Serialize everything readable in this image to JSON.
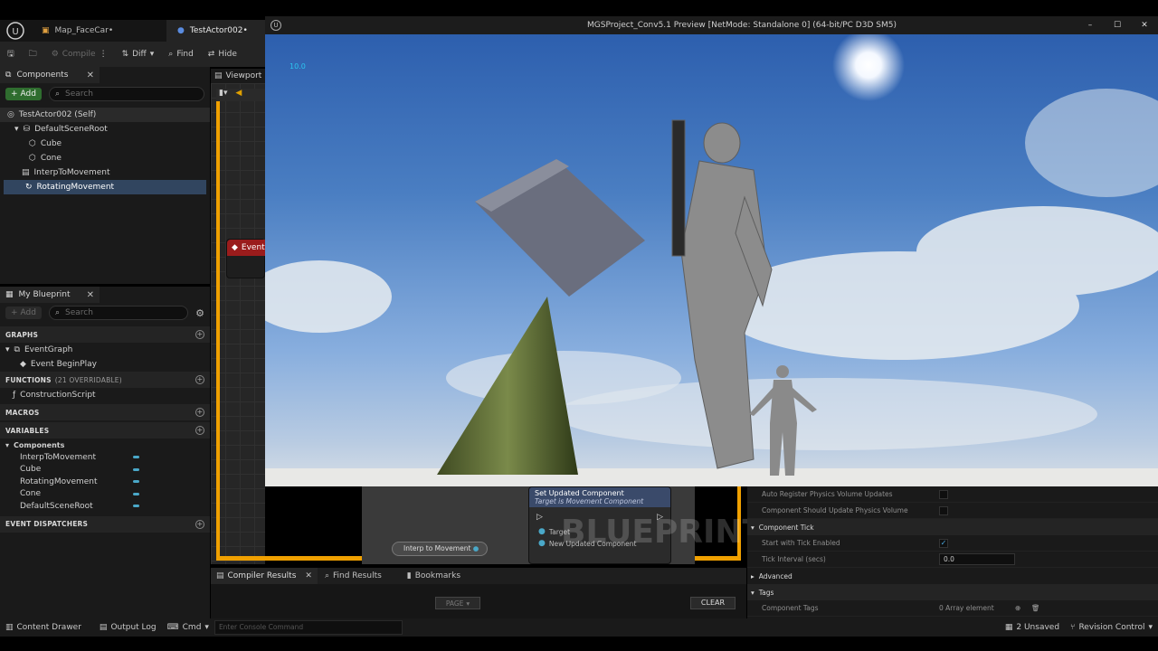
{
  "tabs": [
    {
      "label": "Map_FaceCar•",
      "active": false
    },
    {
      "label": "TestActor002•",
      "active": true
    }
  ],
  "toolbar": {
    "compile": "Compile",
    "diff": "Diff",
    "find": "Find",
    "hide": "Hide"
  },
  "components_panel": {
    "title": "Components",
    "add": "Add",
    "search_placeholder": "Search",
    "items": [
      {
        "label": "TestActor002 (Self)"
      },
      {
        "label": "DefaultSceneRoot"
      },
      {
        "label": "Cube"
      },
      {
        "label": "Cone"
      },
      {
        "label": "InterpToMovement"
      },
      {
        "label": "RotatingMovement"
      }
    ]
  },
  "my_blueprint": {
    "title": "My Blueprint",
    "add": "Add",
    "search_placeholder": "Search",
    "graphs_header": "GRAPHS",
    "event_graph": "EventGraph",
    "begin_play": "Event BeginPlay",
    "functions_header": "FUNCTIONS",
    "functions_count": "(21 OVERRIDABLE)",
    "construction_script": "ConstructionScript",
    "macros_header": "MACROS",
    "variables_header": "VARIABLES",
    "components_group": "Components",
    "variables": [
      "InterpToMovement",
      "Cube",
      "RotatingMovement",
      "Cone",
      "DefaultSceneRoot"
    ],
    "dispatchers_header": "EVENT DISPATCHERS"
  },
  "viewport_tab": "Viewport",
  "graph_node_event": "Event",
  "preview_window": {
    "title": "MGSProject_Conv5.1 Preview [NetMode: Standalone 0]  (64-bit/PC D3D SM5)",
    "overlay_value": "10.0"
  },
  "bottom_graph": {
    "node_title": "Set Updated Component",
    "node_subtitle": "Target is Movement Component",
    "pin_target": "Target",
    "pin_new": "New Updated Component",
    "interp_node": "Interp to Movement",
    "watermark": "BLUEPRINT"
  },
  "bottom_tabs": {
    "compiler_results": "Compiler Results",
    "find_results": "Find Results",
    "bookmarks": "Bookmarks",
    "page": "PAGE",
    "clear": "CLEAR"
  },
  "details": {
    "row1": "Auto Register Physics Volume Updates",
    "row2": "Component Should Update Physics Volume",
    "component_tick": "Component Tick",
    "start_tick": "Start with Tick Enabled",
    "tick_interval": "Tick Interval (secs)",
    "tick_interval_value": "0.0",
    "advanced": "Advanced",
    "tags": "Tags",
    "component_tags": "Component Tags",
    "array_value": "0 Array element"
  },
  "statusbar": {
    "content_drawer": "Content Drawer",
    "output_log": "Output Log",
    "cmd": "Cmd",
    "console_placeholder": "Enter Console Command",
    "unsaved": "2 Unsaved",
    "revision": "Revision Control"
  }
}
